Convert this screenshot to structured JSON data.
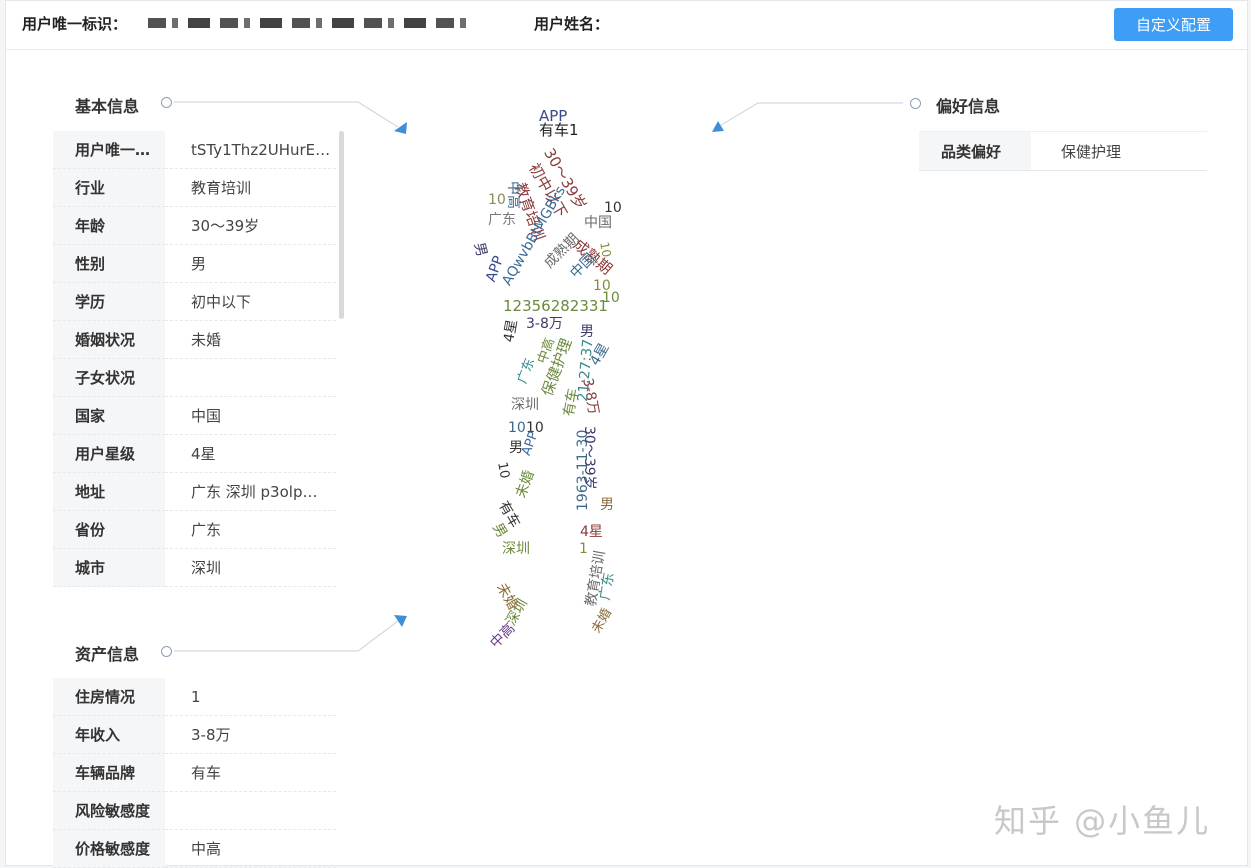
{
  "header": {
    "uid_label": "用户唯一标识：",
    "name_label": "用户姓名：",
    "config_button": "自定义配置"
  },
  "basic": {
    "title": "基本信息",
    "rows": [
      {
        "k": "用户唯一…",
        "v": "tSTy1Thz2UHurE…"
      },
      {
        "k": "行业",
        "v": "教育培训"
      },
      {
        "k": "年龄",
        "v": "30～39岁"
      },
      {
        "k": "性别",
        "v": "男"
      },
      {
        "k": "学历",
        "v": "初中以下"
      },
      {
        "k": "婚姻状况",
        "v": "未婚"
      },
      {
        "k": "子女状况",
        "v": ""
      },
      {
        "k": "国家",
        "v": "中国"
      },
      {
        "k": "用户星级",
        "v": "4星"
      },
      {
        "k": "地址",
        "v": "广东 深圳 p3olp…"
      },
      {
        "k": "省份",
        "v": "广东"
      },
      {
        "k": "城市",
        "v": "深圳"
      }
    ]
  },
  "preference": {
    "title": "偏好信息",
    "rows": [
      {
        "k": "品类偏好",
        "v": "保健护理"
      }
    ]
  },
  "asset": {
    "title": "资产信息",
    "rows": [
      {
        "k": "住房情况",
        "v": "1"
      },
      {
        "k": "年收入",
        "v": "3-8万"
      },
      {
        "k": "车辆品牌",
        "v": "有车"
      },
      {
        "k": "风险敏感度",
        "v": ""
      },
      {
        "k": "价格敏感度",
        "v": "中高"
      }
    ]
  },
  "cloud_words": [
    {
      "t": "APP",
      "c": "#3b4a8c"
    },
    {
      "t": "有车1",
      "c": "#222222"
    },
    {
      "t": "30～39岁",
      "c": "#8a3b3b"
    },
    {
      "t": "初中以下",
      "c": "#8a3b3b"
    },
    {
      "t": "10",
      "c": "#333333"
    },
    {
      "t": "中国",
      "c": "#6b6b6b"
    },
    {
      "t": "教育培训",
      "c": "#8a3b3b"
    },
    {
      "t": "10",
      "c": "#8a8a5a"
    },
    {
      "t": "中高",
      "c": "#3b6b8a"
    },
    {
      "t": "广东",
      "c": "#7a7a7a"
    },
    {
      "t": "AQwvbBtMGBks",
      "c": "#3b6b9a"
    },
    {
      "t": "APP",
      "c": "#3b4a8c"
    },
    {
      "t": "成熟期",
      "c": "#8a3b3b"
    },
    {
      "t": "男",
      "c": "#3b3b6b"
    },
    {
      "t": "10",
      "c": "#8a8a3a"
    },
    {
      "t": "成熟期",
      "c": "#6b6b6b"
    },
    {
      "t": "中国",
      "c": "#3b6b8a"
    },
    {
      "t": "10",
      "c": "#8a8a3a"
    },
    {
      "t": "12356282331",
      "c": "#6b8a3b"
    },
    {
      "t": "10",
      "c": "#6b8a3b"
    },
    {
      "t": "3-8万",
      "c": "#3b3b6b"
    },
    {
      "t": "男",
      "c": "#3b3b6b"
    },
    {
      "t": "4星",
      "c": "#333333"
    },
    {
      "t": "广东",
      "c": "#3b8a8a"
    },
    {
      "t": "中高",
      "c": "#6b8a3b"
    },
    {
      "t": "保健护理",
      "c": "#6b8a3b"
    },
    {
      "t": "4星",
      "c": "#3b6b8a"
    },
    {
      "t": "3-8万",
      "c": "#8a3b3b"
    },
    {
      "t": "深圳",
      "c": "#6b6b6b"
    },
    {
      "t": "有车",
      "c": "#6b8a3b"
    },
    {
      "t": "21:27:37",
      "c": "#3b8a8a"
    },
    {
      "t": "10",
      "c": "#3b6b8a"
    },
    {
      "t": "10",
      "c": "#333333"
    },
    {
      "t": "APP",
      "c": "#3b6b9a"
    },
    {
      "t": "男",
      "c": "#333333"
    },
    {
      "t": "1963-11-30",
      "c": "#3b6b8a"
    },
    {
      "t": "30～39岁",
      "c": "#3b3b6b"
    },
    {
      "t": "10",
      "c": "#333333"
    },
    {
      "t": "未婚",
      "c": "#6b8a3b"
    },
    {
      "t": "男",
      "c": "#8a6b3b"
    },
    {
      "t": "有车",
      "c": "#333333"
    },
    {
      "t": "男",
      "c": "#6b8a3b"
    },
    {
      "t": "4星",
      "c": "#8a3b3b"
    },
    {
      "t": "深圳",
      "c": "#6b8a3b"
    },
    {
      "t": "1",
      "c": "#8a8a3a"
    },
    {
      "t": "教育培训",
      "c": "#6b6b6b"
    },
    {
      "t": "未婚",
      "c": "#8a6b3b"
    },
    {
      "t": "广东",
      "c": "#3b8a8a"
    },
    {
      "t": "深圳",
      "c": "#6b8a3b"
    },
    {
      "t": "中高",
      "c": "#6b3b8a"
    },
    {
      "t": "未婚",
      "c": "#8a6b3b"
    }
  ],
  "watermark": "知乎 @小鱼儿"
}
